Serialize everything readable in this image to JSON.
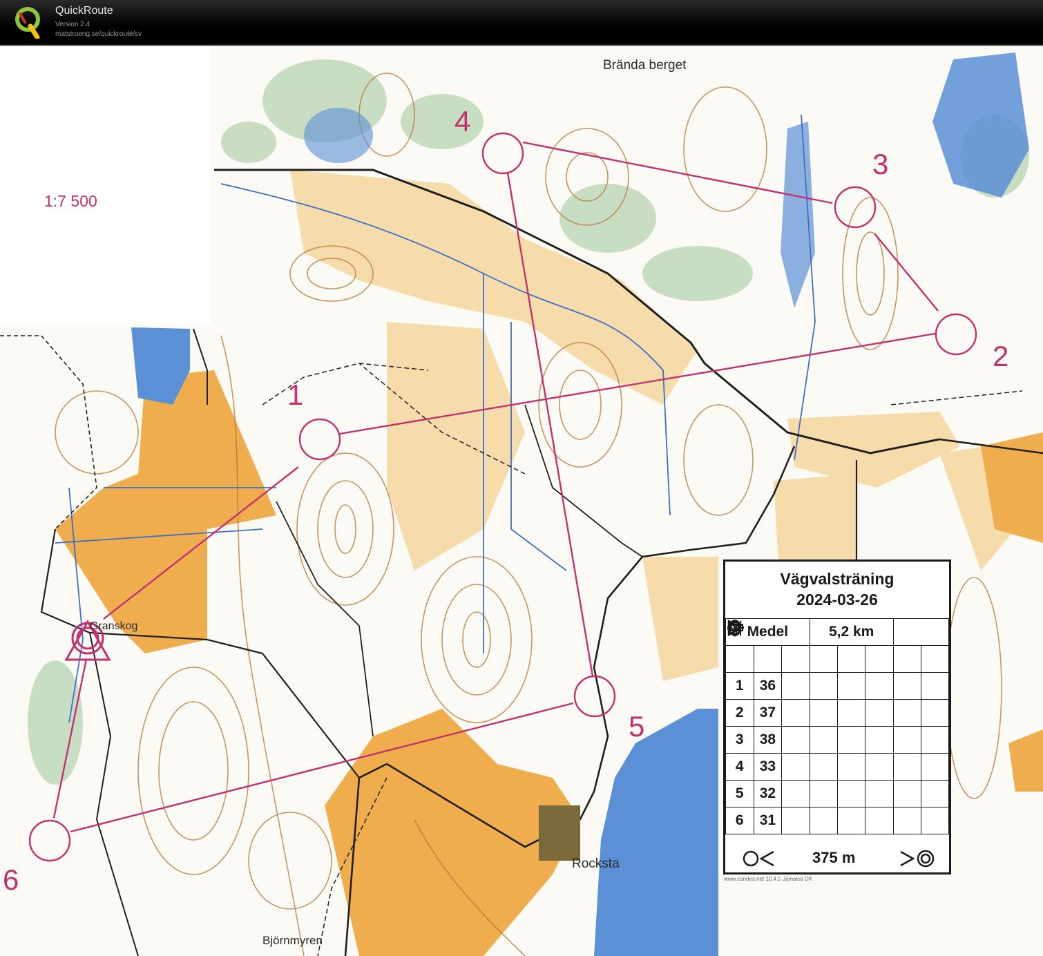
{
  "app": {
    "name": "QuickRoute",
    "version": "Version 2.4",
    "url": "matstroeng.se/quickroute/sv"
  },
  "map": {
    "scale": "1:7 500",
    "places": [
      "Brända berget",
      "Granskog",
      "Rocksta",
      "Björnmyren"
    ],
    "controls": [
      {
        "label": "1"
      },
      {
        "label": "2"
      },
      {
        "label": "3"
      },
      {
        "label": "4"
      },
      {
        "label": "5"
      },
      {
        "label": "6"
      }
    ],
    "course_color": "#c2306e"
  },
  "description": {
    "title": "Vägvalsträning",
    "date": "2024-03-26",
    "class": "Medel",
    "length": "5,2 km",
    "rows": [
      {
        "num": "1",
        "code": "36",
        "feature": "knoll-icon"
      },
      {
        "num": "2",
        "code": "37",
        "feature": "reentrant-icon"
      },
      {
        "num": "3",
        "code": "38",
        "feature": "knoll-icon"
      },
      {
        "num": "4",
        "code": "33",
        "feature": "depression-icon",
        "position": "side-icon"
      },
      {
        "num": "5",
        "code": "32",
        "feature": "wall-icon",
        "direction": "crossing-icon"
      },
      {
        "num": "6",
        "code": "31",
        "feature": "knoll-icon",
        "extra": "shallow-depression-icon"
      }
    ],
    "finish_distance": "375 m",
    "credit": "www.condes.net 10.4.5 Jamaica DK"
  }
}
